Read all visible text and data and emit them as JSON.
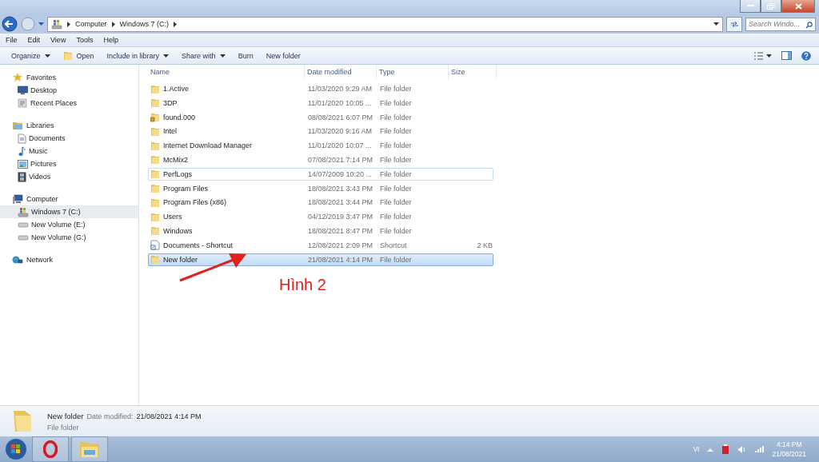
{
  "address_bar": {
    "crumbs": [
      "Computer",
      "Windows 7 (C:)"
    ]
  },
  "search": {
    "placeholder": "Search Windo..."
  },
  "menu": [
    "File",
    "Edit",
    "View",
    "Tools",
    "Help"
  ],
  "toolbar": [
    {
      "label": "Organize",
      "kind": "dropdown"
    },
    {
      "label": "Open",
      "kind": "icon"
    },
    {
      "label": "Include in library",
      "kind": "dropdown"
    },
    {
      "label": "Share with",
      "kind": "dropdown"
    },
    {
      "label": "Burn",
      "kind": "plain"
    },
    {
      "label": "New folder",
      "kind": "plain"
    }
  ],
  "sidebar": [
    {
      "label": "Favorites",
      "children": [
        {
          "label": "Desktop",
          "selected": false
        },
        {
          "label": "Recent Places",
          "selected": false
        }
      ]
    },
    {
      "label": "Libraries",
      "children": [
        {
          "label": "Documents",
          "selected": false
        },
        {
          "label": "Music",
          "selected": false
        },
        {
          "label": "Pictures",
          "selected": false
        },
        {
          "label": "Videos",
          "selected": false
        }
      ]
    },
    {
      "label": "Computer",
      "children": [
        {
          "label": "Windows 7 (C:)",
          "selected": true
        },
        {
          "label": "New Volume (E:)",
          "selected": false
        },
        {
          "label": "New Volume (G:)",
          "selected": false
        }
      ]
    },
    {
      "label": "Network"
    }
  ],
  "table": {
    "columns": [
      "Name",
      "Date modified",
      "Type",
      "Size"
    ],
    "rows": [
      {
        "kind": "folder",
        "name": "1.Active",
        "date": "11/03/2020 9:29 AM",
        "type": "File folder",
        "selected": false,
        "hovered": false
      },
      {
        "kind": "folder",
        "name": "3DP",
        "date": "11/01/2020 10:05 ...",
        "type": "File folder",
        "selected": false,
        "hovered": false
      },
      {
        "kind": "locked",
        "name": "found.000",
        "date": "08/08/2021 6:07 PM",
        "type": "File folder",
        "selected": false,
        "hovered": false
      },
      {
        "kind": "folder",
        "name": "Intel",
        "date": "11/03/2020 9:16 AM",
        "type": "File folder",
        "selected": false,
        "hovered": false
      },
      {
        "kind": "folder",
        "name": "Internet Download Manager",
        "date": "11/01/2020 10:07 ...",
        "type": "File folder",
        "selected": false,
        "hovered": false
      },
      {
        "kind": "folder",
        "name": "McMix2",
        "date": "07/08/2021 7:14 PM",
        "type": "File folder",
        "selected": false,
        "hovered": false
      },
      {
        "kind": "folder",
        "name": "PerfLogs",
        "date": "14/07/2009 10:20 ...",
        "type": "File folder",
        "selected": false,
        "hovered": true
      },
      {
        "kind": "folder",
        "name": "Program Files",
        "date": "18/08/2021 3:43 PM",
        "type": "File folder",
        "selected": false,
        "hovered": false
      },
      {
        "kind": "folder",
        "name": "Program Files (x86)",
        "date": "18/08/2021 3:44 PM",
        "type": "File folder",
        "selected": false,
        "hovered": false
      },
      {
        "kind": "folder",
        "name": "Users",
        "date": "04/12/2019 3:47 PM",
        "type": "File folder",
        "selected": false,
        "hovered": false
      },
      {
        "kind": "folder",
        "name": "Windows",
        "date": "18/08/2021 8:47 PM",
        "type": "File folder",
        "selected": false,
        "hovered": false
      },
      {
        "kind": "shortcut",
        "name": "Documents - Shortcut",
        "date": "12/08/2021 2:09 PM",
        "type": "Shortcut",
        "size": "2 KB",
        "selected": false,
        "hovered": false
      },
      {
        "kind": "folder",
        "name": "New folder",
        "date": "21/08/2021 4:14 PM",
        "type": "File folder",
        "selected": true,
        "hovered": false
      }
    ]
  },
  "annotation": "Hình 2",
  "details": {
    "name": "New folder",
    "date_label": "Date modified:",
    "date": "21/08/2021 4:14 PM",
    "type": "File folder"
  },
  "tray": {
    "language": "VI",
    "time": "4:14 PM",
    "date": "21/08/2021"
  }
}
